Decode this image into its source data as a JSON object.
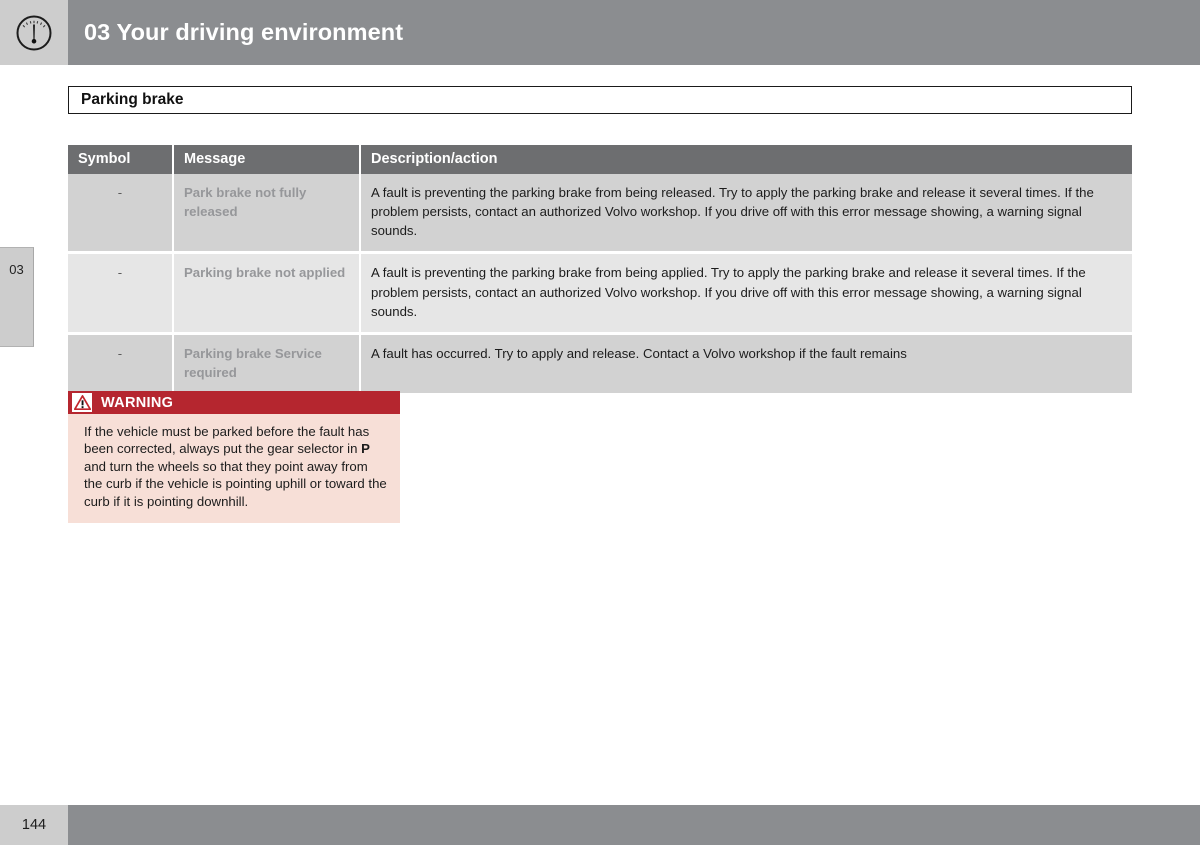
{
  "header": {
    "chapter_number": "03",
    "title": "03 Your driving environment",
    "icon": "speedometer-gauge-icon",
    "bar_color": "#8b8d90",
    "icon_block_color": "#cdcdcd"
  },
  "chapter_tab": {
    "label": "03"
  },
  "section": {
    "heading": "Parking brake"
  },
  "table": {
    "columns": [
      "Symbol",
      "Message",
      "Description/action"
    ],
    "header_bg": "#6d6e70",
    "rows": [
      {
        "symbol": "-",
        "message": "Park brake not fully released",
        "description": "A fault is preventing the parking brake from being released. Try to apply the parking brake and release it several times. If the problem persists, contact an authorized Volvo workshop. If you drive off with this error message showing, a warning signal sounds."
      },
      {
        "symbol": "-",
        "message": "Parking brake not applied",
        "description": "A fault is preventing the parking brake from being applied. Try to apply the parking brake and release it several times. If the problem persists, contact an authorized Volvo workshop. If you drive off with this error message showing, a warning signal sounds."
      },
      {
        "symbol": "-",
        "message": "Parking brake Service required",
        "description": "A fault has occurred. Try to apply and release. Contact a Volvo workshop if the fault remains"
      }
    ]
  },
  "warning": {
    "icon": "warning-triangle-icon",
    "title": "WARNING",
    "header_color": "#b5262f",
    "body_color": "#f7dfd7",
    "text_before": "If the vehicle must be parked before the fault has been corrected, always put the gear selector in ",
    "emphasis": "P",
    "text_after": " and turn the wheels so that they point away from the curb if the vehicle is pointing uphill or toward the curb if it is pointing downhill."
  },
  "footer": {
    "page_number": "144",
    "bar_color": "#8b8d90"
  }
}
